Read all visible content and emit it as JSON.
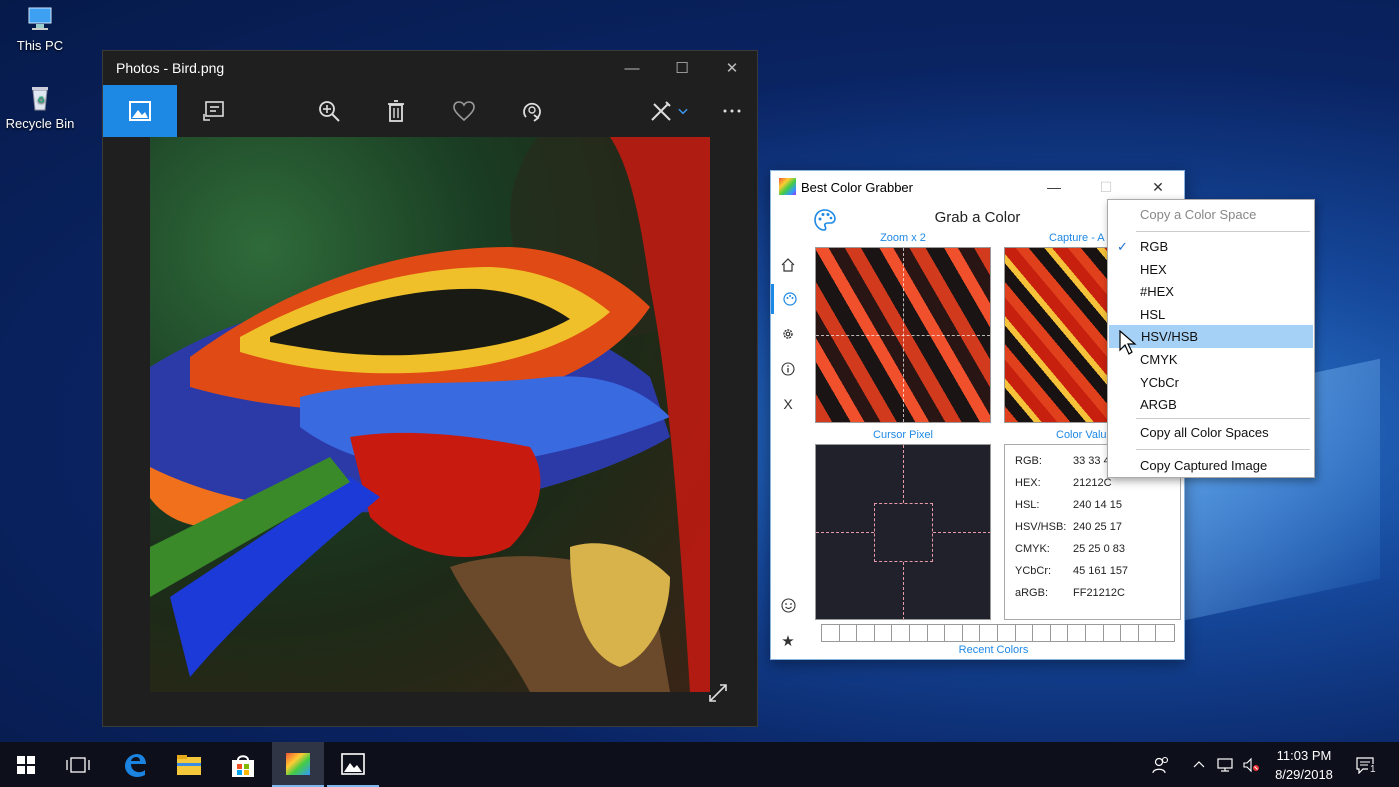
{
  "desktop": {
    "icons": [
      {
        "label": "This PC"
      },
      {
        "label": "Recycle Bin"
      }
    ]
  },
  "photos_window": {
    "title": "Photos - Bird.png",
    "toolbar": [
      "photo-view-icon",
      "slideshow-icon",
      "zoom-in-icon",
      "delete-icon",
      "favorite-heart-icon",
      "rotate-icon",
      "edit-draw-icon",
      "more-icon"
    ]
  },
  "grabber": {
    "title": "Best Color Grabber",
    "heading": "Grab a Color",
    "zoom_caption": "Zoom x 2",
    "capture_caption": "Capture - A",
    "cursor_caption": "Cursor Pixel",
    "values_caption": "Color Valu",
    "recent_caption": "Recent Colors",
    "close_label": "X",
    "values": [
      {
        "key": "RGB:",
        "val": "33 33 4"
      },
      {
        "key": "HEX:",
        "val": "21212C"
      },
      {
        "key": "HSL:",
        "val": "240 14 15"
      },
      {
        "key": "HSV/HSB:",
        "val": "240 25 17"
      },
      {
        "key": "CMYK:",
        "val": "25 25 0 83"
      },
      {
        "key": "YCbCr:",
        "val": "45 161 157"
      },
      {
        "key": "aRGB:",
        "val": "FF21212C"
      }
    ],
    "cursor_color": "#21212C",
    "recent_slots": 20
  },
  "menu": {
    "header": "Copy a Color Space",
    "items": [
      "RGB",
      "HEX",
      "#HEX",
      "HSL",
      "HSV/HSB",
      "CMYK",
      "YCbCr",
      "ARGB"
    ],
    "checked": "RGB",
    "highlighted": "HSV/HSB",
    "copy_all": "Copy all Color Spaces",
    "copy_image": "Copy Captured Image"
  },
  "taskbar": {
    "time": "11:03 PM",
    "date": "8/29/2018",
    "notification_count": "1"
  }
}
